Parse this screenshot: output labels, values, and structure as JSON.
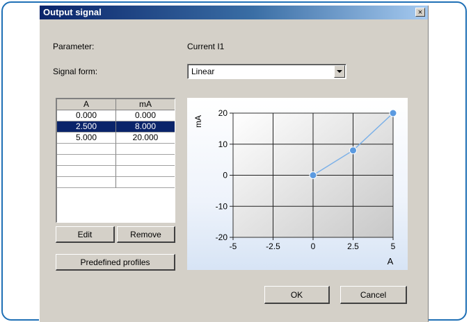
{
  "dialog": {
    "title": "Output signal",
    "close_glyph": "×"
  },
  "form": {
    "parameter_label": "Parameter:",
    "parameter_value": "Current I1",
    "signal_form_label": "Signal form:",
    "signal_form_value": "Linear"
  },
  "table": {
    "columns": [
      "A",
      "mA"
    ],
    "rows": [
      {
        "a": "0.000",
        "ma": "0.000",
        "selected": false
      },
      {
        "a": "2.500",
        "ma": "8.000",
        "selected": true
      },
      {
        "a": "5.000",
        "ma": "20.000",
        "selected": false
      }
    ],
    "empty_rows": 4
  },
  "buttons": {
    "edit": "Edit",
    "remove": "Remove",
    "predefined": "Predefined profiles",
    "ok": "OK",
    "cancel": "Cancel"
  },
  "chart_data": {
    "type": "line",
    "x": [
      0,
      2.5,
      5
    ],
    "y": [
      0,
      8,
      20
    ],
    "xlabel": "A",
    "ylabel": "mA",
    "xlim": [
      -5,
      5
    ],
    "ylim": [
      -20,
      20
    ],
    "x_ticks": [
      "-5",
      "-2.5",
      "0",
      "2.5",
      "5"
    ],
    "y_ticks": [
      "20",
      "10",
      "0",
      "-10",
      "-20"
    ],
    "grid": true,
    "colors": {
      "line": "#7ab0e8",
      "point": "#5b9ae0"
    }
  }
}
